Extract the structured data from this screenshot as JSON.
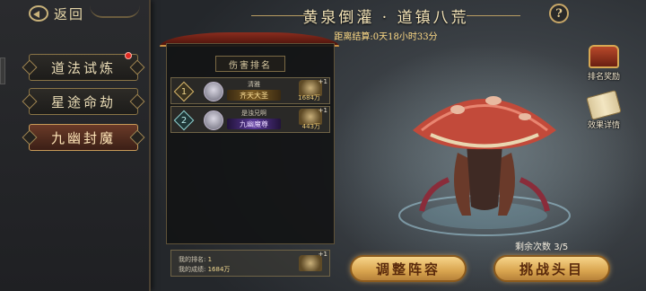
{
  "nav": {
    "back_label": "返回"
  },
  "menu": [
    {
      "label": "道法试炼",
      "has_notification": true,
      "active": false
    },
    {
      "label": "星途命劫",
      "active": false
    },
    {
      "label": "九幽封魔",
      "active": true
    }
  ],
  "header": {
    "title": "黄泉倒灌 · 道镇八荒",
    "countdown_prefix": "距离结算:",
    "countdown_value": "0天18小时33分",
    "help_label": "?"
  },
  "ranking": {
    "title": "伤害排名",
    "rows": [
      {
        "rank": "1",
        "name": "清雅",
        "title": "齐天大圣",
        "damage": "1684万",
        "reward_qty": "+1"
      },
      {
        "rank": "2",
        "name": "是浊兄啊",
        "title": "九幽魔尊",
        "damage": "443万",
        "reward_qty": "+1"
      }
    ],
    "my_rank_label": "我的排名:",
    "my_rank_value": "1",
    "my_score_label": "我的成绩:",
    "my_score_value": "1684万",
    "my_reward_qty": "+1"
  },
  "actions": {
    "adjust_label": "调整阵容",
    "challenge_label": "挑战头目"
  },
  "boss": {
    "remaining_label": "剩余次数",
    "remaining_value": "3/5"
  },
  "side_icons": {
    "rank_reward_label": "排名奖励",
    "effect_detail_label": "效果详情"
  },
  "colors": {
    "gold_text": "#e9c874",
    "active_menu": "#6a3a28",
    "button_gold": "#d9a54f"
  }
}
